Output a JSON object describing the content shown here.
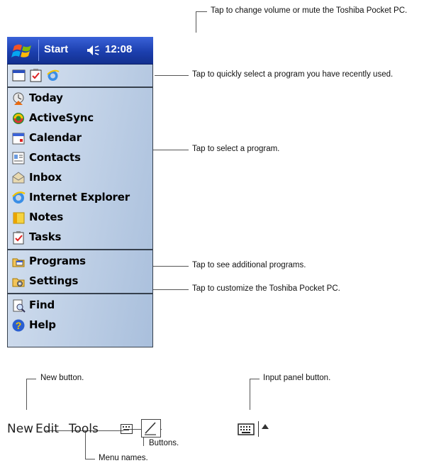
{
  "callouts": {
    "volume": "Tap to change volume or mute the Toshiba Pocket PC.",
    "recent": "Tap to quickly select a program you have recently used.",
    "select_program": "Tap to select a program.",
    "additional": "Tap to see additional programs.",
    "customize": "Tap to customize the Toshiba Pocket PC.",
    "new_button": "New button.",
    "input_panel": "Input panel button.",
    "buttons": "Buttons.",
    "menu_names": "Menu names."
  },
  "titlebar": {
    "start": "Start",
    "time": "12:08"
  },
  "menu": {
    "programs": [
      {
        "label": "Today",
        "icon": "today-icon"
      },
      {
        "label": "ActiveSync",
        "icon": "activesync-icon"
      },
      {
        "label": "Calendar",
        "icon": "calendar-icon"
      },
      {
        "label": "Contacts",
        "icon": "contacts-icon"
      },
      {
        "label": "Inbox",
        "icon": "inbox-icon"
      },
      {
        "label": "Internet Explorer",
        "icon": "internet-explorer-icon"
      },
      {
        "label": "Notes",
        "icon": "notes-icon"
      },
      {
        "label": "Tasks",
        "icon": "tasks-icon"
      }
    ],
    "folders": [
      {
        "label": "Programs",
        "icon": "programs-folder-icon"
      },
      {
        "label": "Settings",
        "icon": "settings-folder-icon"
      }
    ],
    "tools": [
      {
        "label": "Find",
        "icon": "find-icon"
      },
      {
        "label": "Help",
        "icon": "help-icon"
      }
    ]
  },
  "toolbar": {
    "new": "New",
    "edit": "Edit",
    "tools": "Tools"
  },
  "colors": {
    "titlebar": "#1c3fae",
    "menu_bg": "#c3d3e8"
  }
}
